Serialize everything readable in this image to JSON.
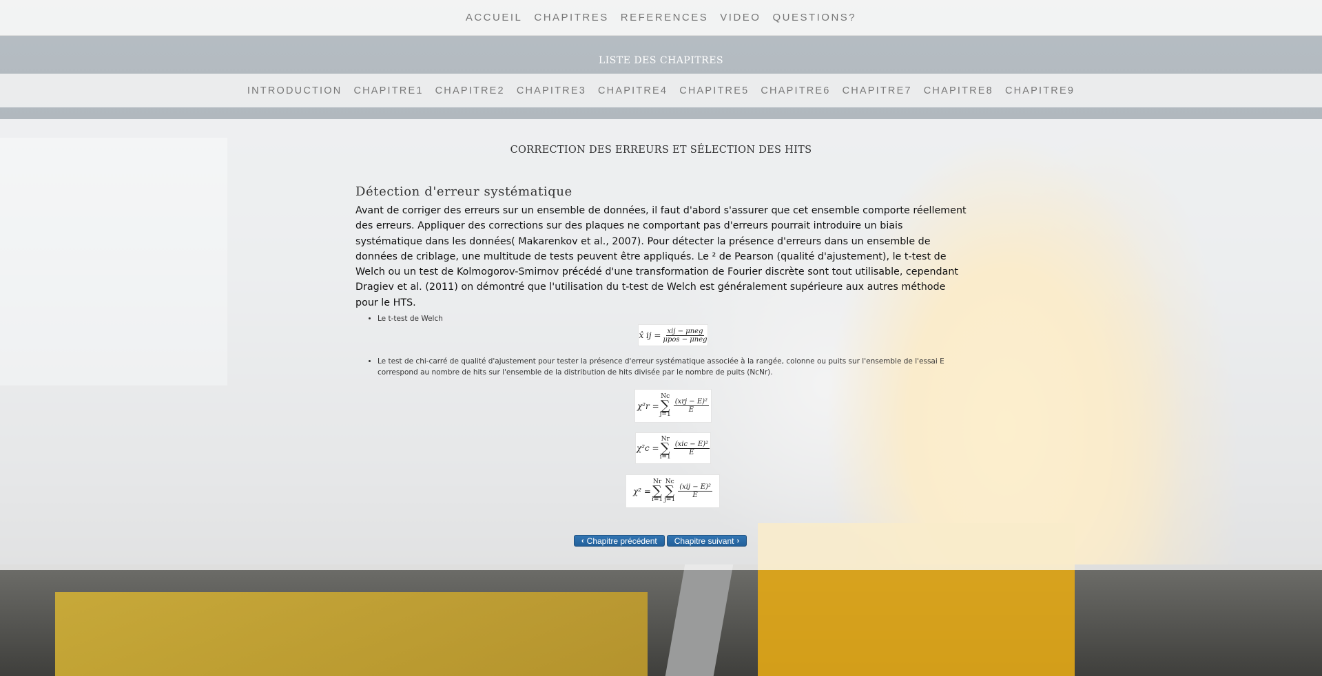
{
  "top_nav": {
    "items": [
      "ACCUEIL",
      "CHAPITRES",
      "REFERENCES",
      "VIDEO",
      "QUESTIONS?"
    ]
  },
  "chapters": {
    "title": "LISTE DES CHAPITRES",
    "items": [
      "INTRODUCTION",
      "CHAPITRE1",
      "CHAPITRE2",
      "CHAPITRE3",
      "CHAPITRE4",
      "CHAPITRE5",
      "CHAPITRE6",
      "CHAPITRE7",
      "CHAPITRE8",
      "CHAPITRE9"
    ]
  },
  "main": {
    "section_title": "CORRECTION DES ERREURS ET SÉLECTION DES HITS",
    "heading": "Détection d'erreur systématique",
    "paragraph": "Avant de corriger des erreurs sur un ensemble de données, il faut d'abord s'assurer que cet ensemble comporte réellement des erreurs. Appliquer des corrections sur des plaques ne comportant pas d'erreurs pourrait introduire un biais systématique dans les données( Makarenkov et al., 2007). Pour détecter la présence d'erreurs dans un ensemble de données de criblage, une multitude de tests peuvent être appliqués. Le ² de Pearson (qualité d'ajustement), le t-test de Welch ou un test de Kolmogorov-Smirnov précédé d'une transformation de Fourier discrète sont tout utilisable, cependant Dragiev et al. (2011) on démontré que l'utilisation du t-test de Welch est généralement supérieure aux autres méthode pour le HTS.",
    "bullet1": "Le t-test de Welch",
    "bullet2": "Le test de chi-carré de qualité d'ajustement pour tester la présence d'erreur systématique associée à la rangée, colonne ou puits sur l'ensemble de l'essai E correspond au nombre de hits sur l'ensemble de la distribution de hits divisée par le nombre de puits (NcNr).",
    "formulas": {
      "f1_lhs": "x̂ ij =",
      "f1_num": "xij − μneg",
      "f1_den": "μpos − μneg",
      "f2_lhs": "χ²r =",
      "f2_sum_top": "Nc",
      "f2_sum_bot": "j=1",
      "f2_num": "(xrj − E)²",
      "f2_den": "E",
      "f3_lhs": "χ²c =",
      "f3_sum_top": "Nr",
      "f3_sum_bot": "i=1",
      "f3_num": "(xic − E)²",
      "f3_den": "E",
      "f4_lhs": "χ² =",
      "f4_sum1_top": "Nr",
      "f4_sum1_bot": "i=1",
      "f4_sum2_top": "Nc",
      "f4_sum2_bot": "j=1",
      "f4_num": "(xij − E)²",
      "f4_den": "E",
      "sigma": "∑"
    },
    "prev_button": "Chapitre précédent",
    "next_button": "Chapitre suivant",
    "prev_icon": "‹",
    "next_icon": "›"
  },
  "colors": {
    "button": "#2a6ba8",
    "accent_yellow": "#e8a81a"
  }
}
